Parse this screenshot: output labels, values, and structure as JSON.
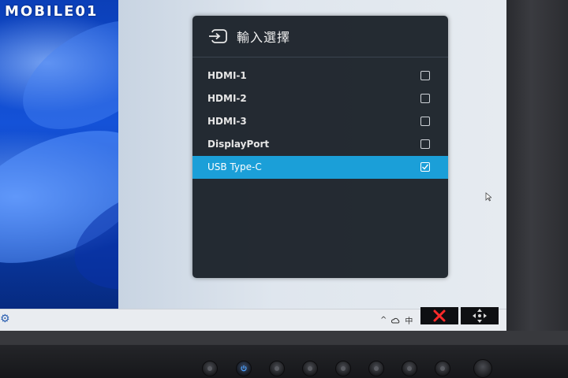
{
  "watermark": "MOBILE01",
  "osd": {
    "title": "輸入選擇",
    "header_icon": "input-source-icon",
    "items": [
      {
        "label": "HDMI-1",
        "selected": false
      },
      {
        "label": "HDMI-2",
        "selected": false
      },
      {
        "label": "HDMI-3",
        "selected": false
      },
      {
        "label": "DisplayPort",
        "selected": false
      },
      {
        "label": "USB Type-C",
        "selected": true
      }
    ],
    "highlight_color": "#1b9fd8"
  },
  "taskbar": {
    "tray_chevron": "^",
    "tray_ime": "中"
  },
  "monitor_keys": {
    "close_icon": "close-x-icon",
    "move_icon": "directional-arrows-icon"
  }
}
